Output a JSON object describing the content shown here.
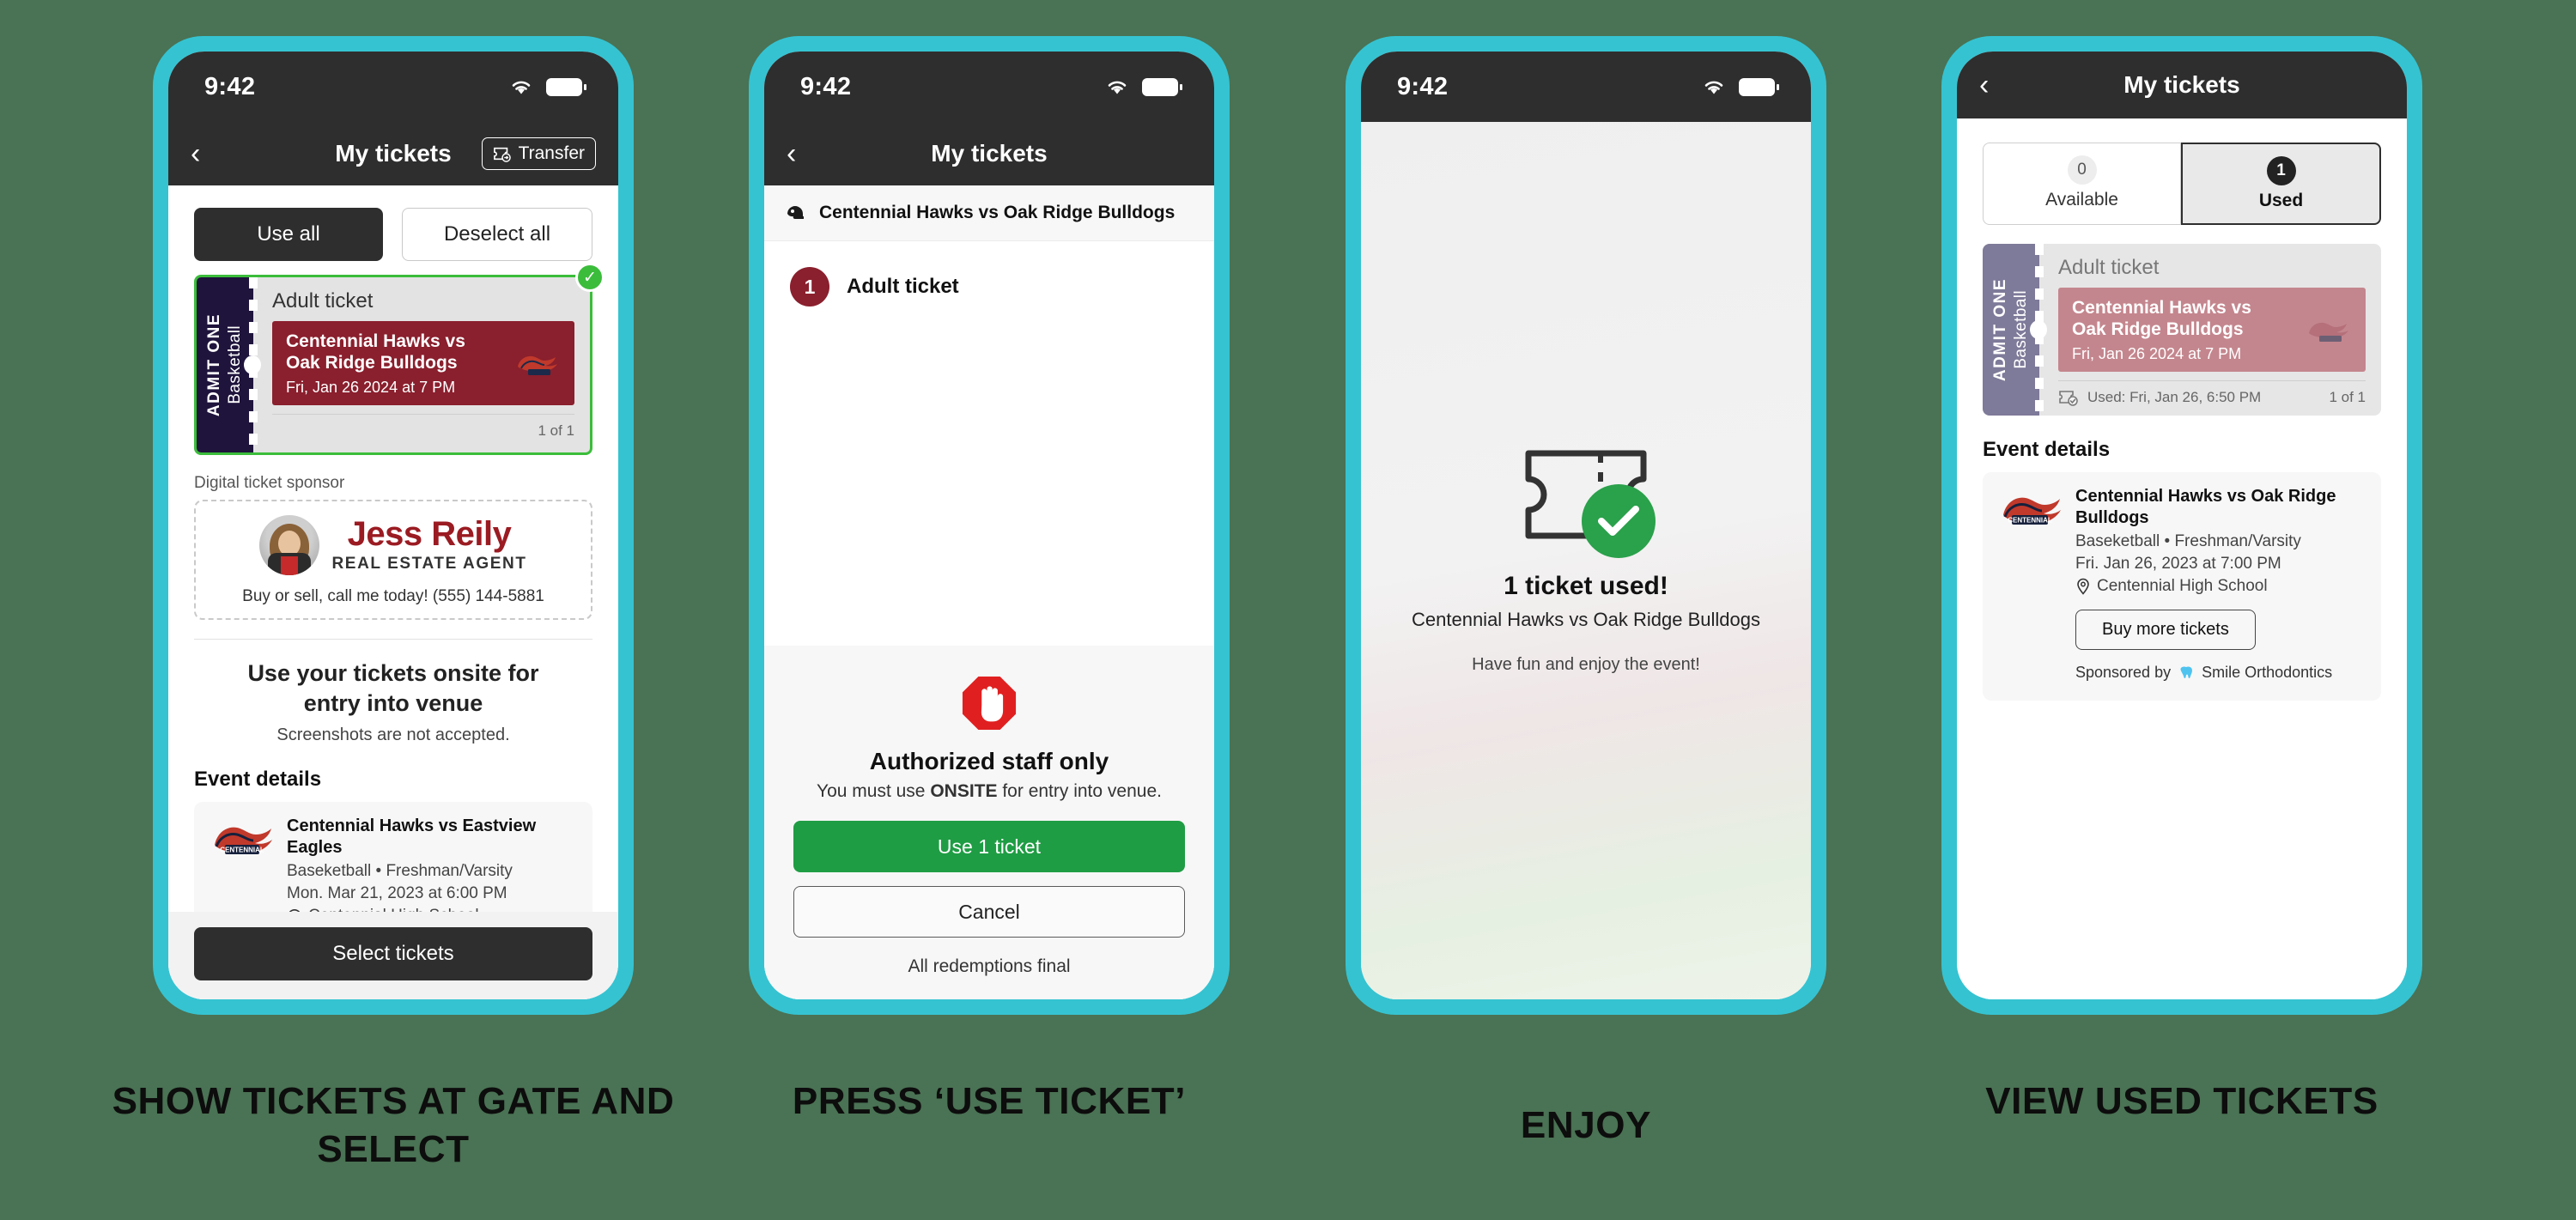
{
  "status_bar": {
    "time": "9:42",
    "wifi_icon": "wifi-icon",
    "battery_icon": "battery-icon"
  },
  "screen1": {
    "nav": {
      "back_icon": "chevron-left-icon",
      "title": "My tickets",
      "transfer_label": "Transfer",
      "transfer_icon": "ticket-transfer-icon"
    },
    "use_all_label": "Use all",
    "deselect_all_label": "Deselect all",
    "ticket": {
      "stub_admit": "ADMIT ONE",
      "stub_sport": "Basketball",
      "type": "Adult ticket",
      "event": "Centennial Hawks vs Oak Ridge Bulldogs",
      "date": "Fri, Jan 26 2024 at 7 PM",
      "count": "1 of 1",
      "selected_icon": "check-circle-icon"
    },
    "sponsor": {
      "label": "Digital ticket sponsor",
      "name": "Jess Reily",
      "role": "REAL ESTATE AGENT",
      "tagline": "Buy or sell, call me today! (555) 144-5881",
      "avatar": "sponsor-headshot"
    },
    "onsite_title": "Use your tickets onsite for entry into venue",
    "onsite_sub": "Screenshots are not accepted.",
    "event_details_heading": "Event details",
    "event_details": {
      "name": "Centennial Hawks vs Eastview Eagles",
      "meta": "Baseketball • Freshman/Varsity",
      "datetime": "Mon. Mar 21, 2023 at 6:00 PM",
      "venue": "Centennial High School",
      "location_icon": "location-pin-icon",
      "logo": "centennial-hawks-logo"
    },
    "select_tickets_label": "Select tickets"
  },
  "screen2": {
    "nav": {
      "back_icon": "chevron-left-icon",
      "title": "My tickets"
    },
    "event_bar": {
      "text": "Centennial Hawks vs Oak Ridge Bulldogs",
      "icon": "helmet-icon"
    },
    "line_item": {
      "qty": "1",
      "label": "Adult ticket"
    },
    "sheet": {
      "stop_icon": "stop-hand-icon",
      "title": "Authorized staff only",
      "sub_prefix": "You must use ",
      "sub_bold": "ONSITE",
      "sub_suffix": " for entry into venue.",
      "use_label": "Use 1 ticket",
      "cancel_label": "Cancel",
      "final_note": "All redemptions final"
    }
  },
  "screen3": {
    "icon": "ticket-check-icon",
    "title": "1 ticket used!",
    "subtitle": "Centennial Hawks vs Oak Ridge Bulldogs",
    "note": "Have fun and enjoy the event!"
  },
  "screen4": {
    "nav": {
      "back_icon": "chevron-left-icon",
      "title": "My tickets"
    },
    "tabs": [
      {
        "count": "0",
        "label": "Available",
        "active": false
      },
      {
        "count": "1",
        "label": "Used",
        "active": true
      }
    ],
    "ticket": {
      "stub_admit": "ADMIT ONE",
      "stub_sport": "Basketball",
      "type": "Adult ticket",
      "event": "Centennial Hawks vs Oak Ridge Bulldogs",
      "date": "Fri, Jan 26 2024 at 7 PM",
      "used_text": "Used: Fri, Jan 26, 6:50 PM",
      "count": "1 of 1",
      "used_icon": "ticket-used-icon"
    },
    "event_details_heading": "Event details",
    "event_details": {
      "name": "Centennial Hawks vs Oak Ridge Bulldogs",
      "meta": "Baseketball • Freshman/Varsity",
      "datetime": "Fri. Jan 26, 2023 at 7:00 PM",
      "venue": "Centennial High School",
      "location_icon": "location-pin-icon",
      "logo": "centennial-hawks-logo",
      "buy_more_label": "Buy more tickets",
      "sponsored_prefix": "Sponsored by",
      "sponsor_name": "Smile Orthodontics",
      "sponsor_icon": "tooth-icon"
    }
  },
  "captions": [
    "SHOW TICKETS AT GATE AND SELECT",
    "PRESS ‘USE TICKET’",
    "ENJOY",
    "VIEW USED TICKETS"
  ],
  "colors": {
    "background": "#4a7254",
    "phone_frame": "#35c3d1",
    "nav_dark": "#2e2e2e",
    "ticket_maroon": "#8a1f2d",
    "select_green": "#3bbd3b",
    "use_green": "#1f9d44",
    "stop_red": "#e02020",
    "stub_navy": "#1f143c",
    "stub_used": "#7e7a99"
  }
}
